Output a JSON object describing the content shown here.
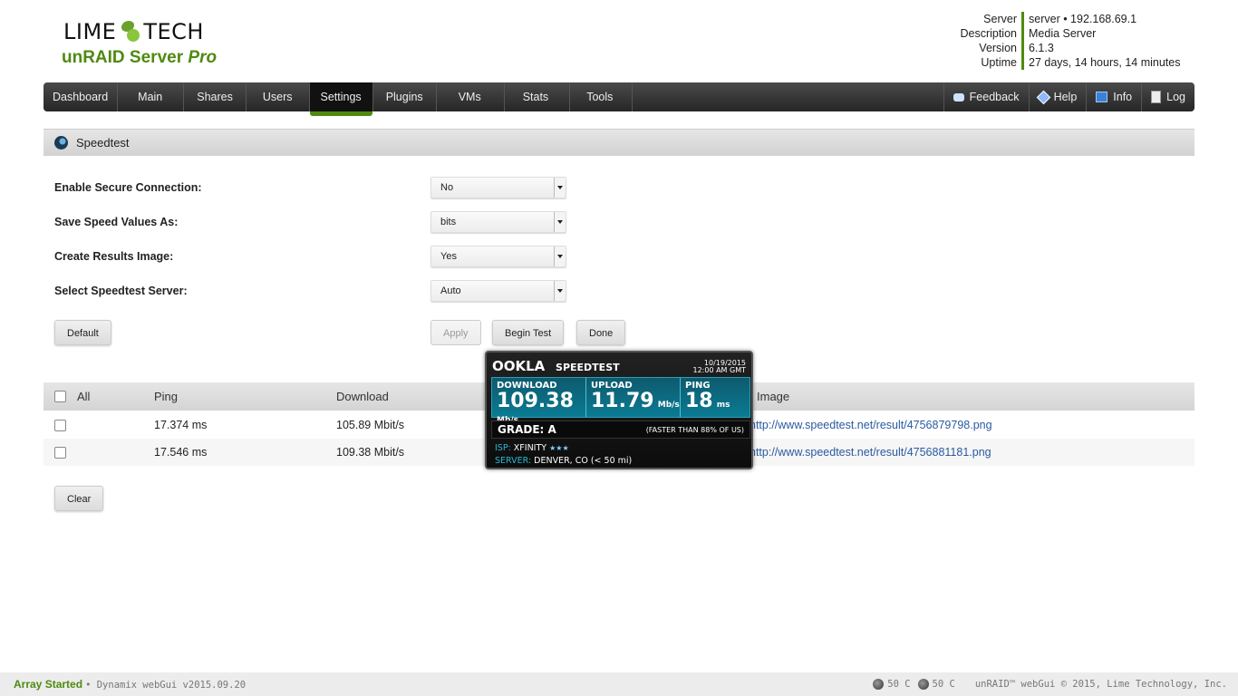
{
  "header": {
    "brand_left": "LIME",
    "brand_right": "TECH",
    "product_main": "unRAID Server",
    "product_edition": "Pro",
    "server_info": [
      {
        "key": "Server",
        "value": "server • 192.168.69.1"
      },
      {
        "key": "Description",
        "value": "Media Server"
      },
      {
        "key": "Version",
        "value": "6.1.3"
      },
      {
        "key": "Uptime",
        "value": "27 days, 14 hours, 14 minutes"
      }
    ]
  },
  "nav": {
    "tabs": [
      {
        "label": "Dashboard"
      },
      {
        "label": "Main"
      },
      {
        "label": "Shares"
      },
      {
        "label": "Users"
      },
      {
        "label": "Settings",
        "active": true
      },
      {
        "label": "Plugins"
      },
      {
        "label": "VMs"
      },
      {
        "label": "Stats"
      },
      {
        "label": "Tools"
      }
    ],
    "right": [
      {
        "label": "Feedback",
        "icon": "feedback-icon"
      },
      {
        "label": "Help",
        "icon": "help-icon"
      },
      {
        "label": "Info",
        "icon": "info-monitor-icon"
      },
      {
        "label": "Log",
        "icon": "log-document-icon"
      }
    ]
  },
  "page": {
    "title": "Speedtest"
  },
  "form": {
    "rows": [
      {
        "label": "Enable Secure Connection:",
        "value": "No"
      },
      {
        "label": "Save Speed Values As:",
        "value": "bits"
      },
      {
        "label": "Create Results Image:",
        "value": "Yes"
      },
      {
        "label": "Select Speedtest Server:",
        "value": "Auto"
      }
    ],
    "buttons": {
      "default": "Default",
      "apply": "Apply",
      "begin": "Begin Test",
      "done": "Done",
      "clear": "Clear"
    }
  },
  "table": {
    "headers": {
      "all": "All",
      "ping": "Ping",
      "download": "Download",
      "image": "Image"
    },
    "rows": [
      {
        "ping": "17.374 ms",
        "download": "105.89 Mbit/s",
        "image": "http://www.speedtest.net/result/4756879798.png"
      },
      {
        "ping": "17.546 ms",
        "download": "109.38 Mbit/s",
        "image": "http://www.speedtest.net/result/4756881181.png"
      }
    ]
  },
  "speedtest_popup": {
    "brand": "OOKLA",
    "product": "SPEEDTEST",
    "date": "10/19/2015",
    "time": "12:00 AM GMT",
    "download_label": "DOWNLOAD",
    "download_value": "109.38",
    "download_unit": "Mb/s",
    "upload_label": "UPLOAD",
    "upload_value": "11.79",
    "upload_unit": "Mb/s",
    "ping_label": "PING",
    "ping_value": "18",
    "ping_unit": "ms",
    "grade": "GRADE: A",
    "faster": "(FASTER THAN 88% OF US)",
    "isp_label": "ISP:",
    "isp_value": "XFINITY",
    "isp_stars": "★★★",
    "server_label": "SERVER:",
    "server_value": "DENVER, CO (< 50 mi)"
  },
  "footer": {
    "status": "Array Started",
    "version": "• Dynamix webGui v2015.09.20",
    "temp1": "50 C",
    "temp2": "50 C",
    "copyright": "unRAID™ webGui © 2015, Lime Technology, Inc."
  },
  "colors": {
    "accent_green": "#4f8a10",
    "link_blue": "#2a5aa0",
    "nav_dark": "#262626",
    "speedtest_teal": "#0a7b93"
  }
}
